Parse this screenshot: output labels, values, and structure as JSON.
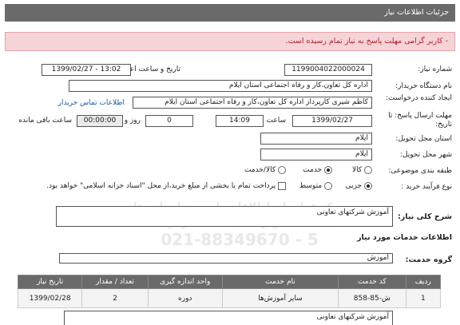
{
  "header": {
    "title": "جزئیات اطلاعات نیاز"
  },
  "alert": {
    "text": "- کاربر گرامی مهلت پاسخ به نیاز تمام رسیده است."
  },
  "form": {
    "need_number_label": "شماره نیاز:",
    "need_number": "1199004022000024",
    "announce_label": "تاریخ و ساعت اعلان عمومی:",
    "announce_value": "1399/02/27 - 13:02",
    "buyer_label": "نام دستگاه خریدار:",
    "buyer": "اداره کل تعاون،کار و رفاه اجتماعی استان ایلام",
    "creator_label": "ایجاد کننده درخواست:",
    "creator": "کاظم شیری کارپرداز اداره کل تعاون،کار و رفاه اجتماعی استان ایلام",
    "contact_link": "اطلاعات تماس خریدار",
    "deadline_label": "مهلت ارسال پاسخ: تا تاریخ:",
    "deadline_date": "1399/02/27",
    "time_label": "ساعت",
    "deadline_time": "14:09",
    "days_value": "0",
    "days_label": "روز و",
    "remaining_value": "00:00:00",
    "remaining_label": "ساعت باقی مانده",
    "province_label": "استان محل تحویل:",
    "province": "ایلام",
    "city_label": "شهر محل تحویل:",
    "city": "ایلام",
    "category_label": "طبقه بندی موضوعی:",
    "category_options": [
      "کالا",
      "خدمت",
      "کالا/خدمت"
    ],
    "purchase_label": "نوع فرآیند خرید :",
    "purchase_options": [
      "جزیی",
      "متوسط"
    ],
    "payment_note": "پرداخت تمام یا بخشی از مبلغ خرید،از محل \"اسناد خزانه اسلامی\" خواهد بود."
  },
  "summary": {
    "label": "شرح کلی نیاز:",
    "value": "آموزش شرکتهای تعاونی"
  },
  "services": {
    "heading": "اطلاعات خدمات مورد نیاز",
    "group_label": "گروه خدمت:",
    "group_value": "آموزش"
  },
  "table": {
    "headers": [
      "ردیف",
      "کد خدمت",
      "نام خدمت",
      "واحد اندازه گیری",
      "تعداد / مقدار",
      "تاریخ نیاز"
    ],
    "rows": [
      [
        "1",
        "ش-85-858",
        "سایر آموزش‌ها",
        "دوره",
        "2",
        "1399/02/28"
      ]
    ]
  },
  "footer_desc": "آموزش شرکتهای تعاونی",
  "watermark": {
    "line1": "مرکز فراخوان اطلاعات پارس نماد داده ها",
    "line2": "پایگاه اطلاع رسانی مناقصه ومزایده",
    "phone": "021-88349670 - 5"
  }
}
